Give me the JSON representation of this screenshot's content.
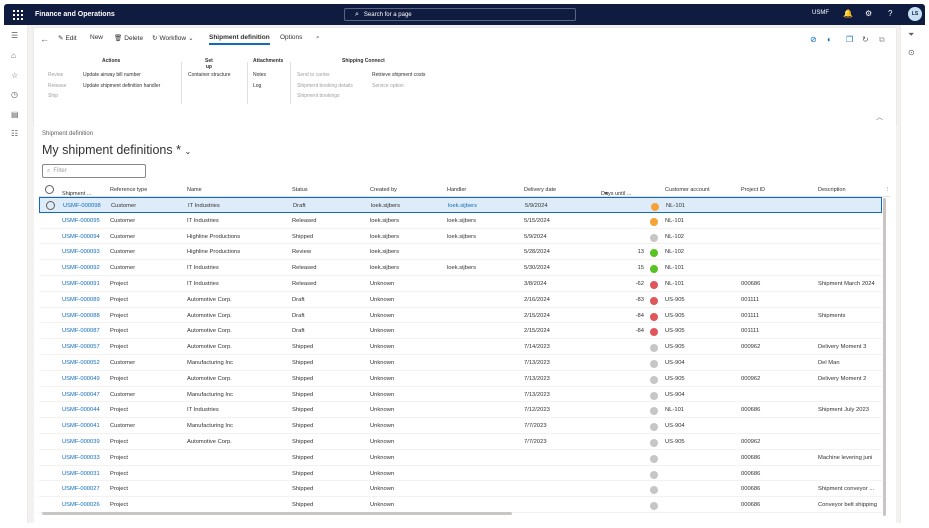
{
  "app": {
    "name": "Finance and Operations",
    "search_placeholder": "Search for a page",
    "company": "USMF",
    "avatar": "LS"
  },
  "toolbar": {
    "edit": "Edit",
    "new": "New",
    "delete": "Delete",
    "workflow": "Workflow",
    "shipment_definition": "Shipment definition",
    "options": "Options"
  },
  "ribbon": {
    "actions": {
      "title": "Actions",
      "col1": [
        "Revise",
        "Release",
        "Ship"
      ],
      "col2": [
        "Update airway bill number",
        "Update shipment definition handler"
      ]
    },
    "setup": {
      "title": "Set up",
      "items": [
        "Container structure"
      ]
    },
    "attachments": {
      "title": "Attachments",
      "items": [
        "Notes",
        "Log"
      ]
    },
    "shipping_connect": {
      "title": "Shipping Connect",
      "col1": [
        "Send to carrier",
        "Shipment booking details",
        "Shipment bookings"
      ],
      "col2": [
        "Retrieve shipment costs",
        "Service option"
      ]
    }
  },
  "page": {
    "breadcrumb": "Shipment definition",
    "view_title": "My shipment definitions *",
    "filter_placeholder": "Filter"
  },
  "columns": [
    "Shipment ...",
    "Reference type",
    "Name",
    "Status",
    "Created by",
    "Handler",
    "Delivery date",
    "Days until ...",
    "Customer account",
    "Project ID",
    "Description"
  ],
  "colors": {
    "accent": "#0f6cbd",
    "topbar": "#0f1c3f",
    "orange": "#f7a236",
    "green": "#58c322",
    "red": "#e0565b",
    "gray": "#c8c6c4"
  },
  "rows": [
    {
      "id": "USMF-000098",
      "ref": "Customer",
      "name": "IT Industries",
      "status": "Draft",
      "created": "loek.sijbers",
      "handler": "loek.sijbers",
      "date": "5/9/2024",
      "days": "",
      "dot": "orange",
      "account": "NL-101",
      "project": "",
      "desc": ""
    },
    {
      "id": "USMF-000095",
      "ref": "Customer",
      "name": "IT Industries",
      "status": "Released",
      "created": "loek.sijbers",
      "handler": "loek.sijbers",
      "date": "5/15/2024",
      "days": "",
      "dot": "orange",
      "account": "NL-101",
      "project": "",
      "desc": ""
    },
    {
      "id": "USMF-000094",
      "ref": "Customer",
      "name": "Highline Productions",
      "status": "Shipped",
      "created": "loek.sijbers",
      "handler": "loek.sijbers",
      "date": "5/9/2024",
      "days": "",
      "dot": "gray",
      "account": "NL-102",
      "project": "",
      "desc": ""
    },
    {
      "id": "USMF-000093",
      "ref": "Customer",
      "name": "Highline Productions",
      "status": "Review",
      "created": "loek.sijbers",
      "handler": "",
      "date": "5/28/2024",
      "days": "13",
      "dot": "green",
      "account": "NL-102",
      "project": "",
      "desc": ""
    },
    {
      "id": "USMF-000092",
      "ref": "Customer",
      "name": "IT Industries",
      "status": "Released",
      "created": "loek.sijbers",
      "handler": "loek.sijbers",
      "date": "5/30/2024",
      "days": "15",
      "dot": "green",
      "account": "NL-101",
      "project": "",
      "desc": ""
    },
    {
      "id": "USMF-000091",
      "ref": "Project",
      "name": "IT Industries",
      "status": "Released",
      "created": "Unknown",
      "handler": "",
      "date": "3/8/2024",
      "days": "-62",
      "dot": "red",
      "account": "NL-101",
      "project": "000686",
      "desc": "Shipment March 2024"
    },
    {
      "id": "USMF-000089",
      "ref": "Project",
      "name": "Automotive Corp.",
      "status": "Draft",
      "created": "Unknown",
      "handler": "",
      "date": "2/16/2024",
      "days": "-83",
      "dot": "red",
      "account": "US-905",
      "project": "001111",
      "desc": ""
    },
    {
      "id": "USMF-000088",
      "ref": "Project",
      "name": "Automotive Corp.",
      "status": "Draft",
      "created": "Unknown",
      "handler": "",
      "date": "2/15/2024",
      "days": "-84",
      "dot": "red",
      "account": "US-905",
      "project": "001111",
      "desc": "Shipments"
    },
    {
      "id": "USMF-000087",
      "ref": "Project",
      "name": "Automotive Corp.",
      "status": "Draft",
      "created": "Unknown",
      "handler": "",
      "date": "2/15/2024",
      "days": "-84",
      "dot": "red",
      "account": "US-905",
      "project": "001111",
      "desc": ""
    },
    {
      "id": "USMF-000057",
      "ref": "Project",
      "name": "Automotive Corp.",
      "status": "Shipped",
      "created": "Unknown",
      "handler": "",
      "date": "7/14/2023",
      "days": "",
      "dot": "gray",
      "account": "US-905",
      "project": "000962",
      "desc": "Delivery Moment 3"
    },
    {
      "id": "USMF-000052",
      "ref": "Customer",
      "name": "Manufacturing Inc",
      "status": "Shipped",
      "created": "Unknown",
      "handler": "",
      "date": "7/13/2023",
      "days": "",
      "dot": "gray",
      "account": "US-904",
      "project": "",
      "desc": "Del Man"
    },
    {
      "id": "USMF-000049",
      "ref": "Project",
      "name": "Automotive Corp.",
      "status": "Shipped",
      "created": "Unknown",
      "handler": "",
      "date": "7/13/2023",
      "days": "",
      "dot": "gray",
      "account": "US-905",
      "project": "000962",
      "desc": "Delivery Moment 2"
    },
    {
      "id": "USMF-000047",
      "ref": "Customer",
      "name": "Manufacturing Inc",
      "status": "Shipped",
      "created": "Unknown",
      "handler": "",
      "date": "7/13/2023",
      "days": "",
      "dot": "gray",
      "account": "US-904",
      "project": "",
      "desc": ""
    },
    {
      "id": "USMF-000044",
      "ref": "Project",
      "name": "IT Industries",
      "status": "Shipped",
      "created": "Unknown",
      "handler": "",
      "date": "7/12/2023",
      "days": "",
      "dot": "gray",
      "account": "NL-101",
      "project": "000686",
      "desc": "Shipment July 2023"
    },
    {
      "id": "USMF-000041",
      "ref": "Customer",
      "name": "Manufacturing Inc",
      "status": "Shipped",
      "created": "Unknown",
      "handler": "",
      "date": "7/7/2023",
      "days": "",
      "dot": "gray",
      "account": "US-904",
      "project": "",
      "desc": ""
    },
    {
      "id": "USMF-000039",
      "ref": "Project",
      "name": "Automotive Corp.",
      "status": "Shipped",
      "created": "Unknown",
      "handler": "",
      "date": "7/7/2023",
      "days": "",
      "dot": "gray",
      "account": "US-905",
      "project": "000962",
      "desc": ""
    },
    {
      "id": "USMF-000033",
      "ref": "Project",
      "name": "",
      "status": "Shipped",
      "created": "Unknown",
      "handler": "",
      "date": "",
      "days": "",
      "dot": "gray",
      "account": "",
      "project": "000686",
      "desc": "Machine levering juni"
    },
    {
      "id": "USMF-000031",
      "ref": "Project",
      "name": "",
      "status": "Shipped",
      "created": "Unknown",
      "handler": "",
      "date": "",
      "days": "",
      "dot": "gray",
      "account": "",
      "project": "000686",
      "desc": ""
    },
    {
      "id": "USMF-000027",
      "ref": "Project",
      "name": "",
      "status": "Shipped",
      "created": "Unknown",
      "handler": "",
      "date": "",
      "days": "",
      "dot": "gray",
      "account": "",
      "project": "000686",
      "desc": "Shipment conveyor ..."
    },
    {
      "id": "USMF-000026",
      "ref": "Project",
      "name": "",
      "status": "Shipped",
      "created": "Unknown",
      "handler": "",
      "date": "",
      "days": "",
      "dot": "gray",
      "account": "",
      "project": "000686",
      "desc": "Conveyor belt shipping"
    }
  ]
}
